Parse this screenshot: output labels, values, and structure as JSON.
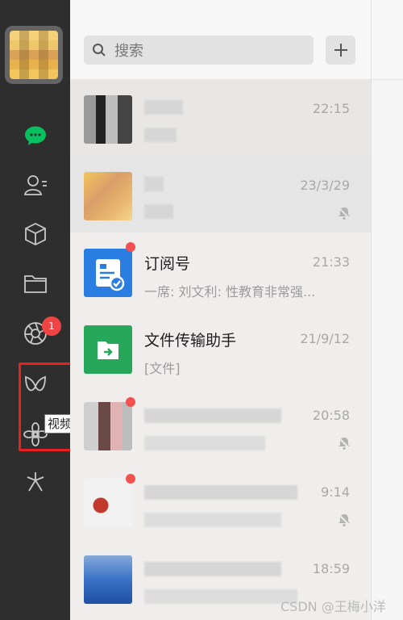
{
  "search": {
    "placeholder": "搜索"
  },
  "sidebar": {
    "items": [
      {
        "id": "chats",
        "icon": "chat-icon",
        "active": true,
        "color": "#07c160"
      },
      {
        "id": "contacts",
        "icon": "contacts-icon"
      },
      {
        "id": "favorites",
        "icon": "cube-icon"
      },
      {
        "id": "files",
        "icon": "folder-icon"
      },
      {
        "id": "moments",
        "icon": "aperture-icon",
        "badge": "1"
      },
      {
        "id": "channels",
        "icon": "channels-icon"
      },
      {
        "id": "search",
        "icon": "flower-icon"
      },
      {
        "id": "mini-programs",
        "icon": "spark-icon"
      }
    ],
    "tooltip": "视频号"
  },
  "chats": [
    {
      "name": "",
      "time": "22:15",
      "msg": "",
      "blurred": true
    },
    {
      "name": "",
      "time": "23/3/29",
      "msg": "",
      "blurred": true,
      "muted": true
    },
    {
      "name": "订阅号",
      "time": "21:33",
      "msg": "一席: 刘文利: 性教育非常强...",
      "unread_dot": true
    },
    {
      "name": "文件传输助手",
      "time": "21/9/12",
      "msg": "[文件]"
    },
    {
      "name": "",
      "time": "20:58",
      "msg": "",
      "blurred": true,
      "muted": true
    },
    {
      "name": "",
      "time": "9:14",
      "msg": "",
      "blurred": true,
      "muted": true
    },
    {
      "name": "",
      "time": "18:59",
      "msg": "",
      "blurred": true
    }
  ],
  "watermark": "CSDN @王梅小洋",
  "colors": {
    "accent_green": "#07c160",
    "badge_red": "#f04444",
    "highlight_red": "#e8201f"
  }
}
